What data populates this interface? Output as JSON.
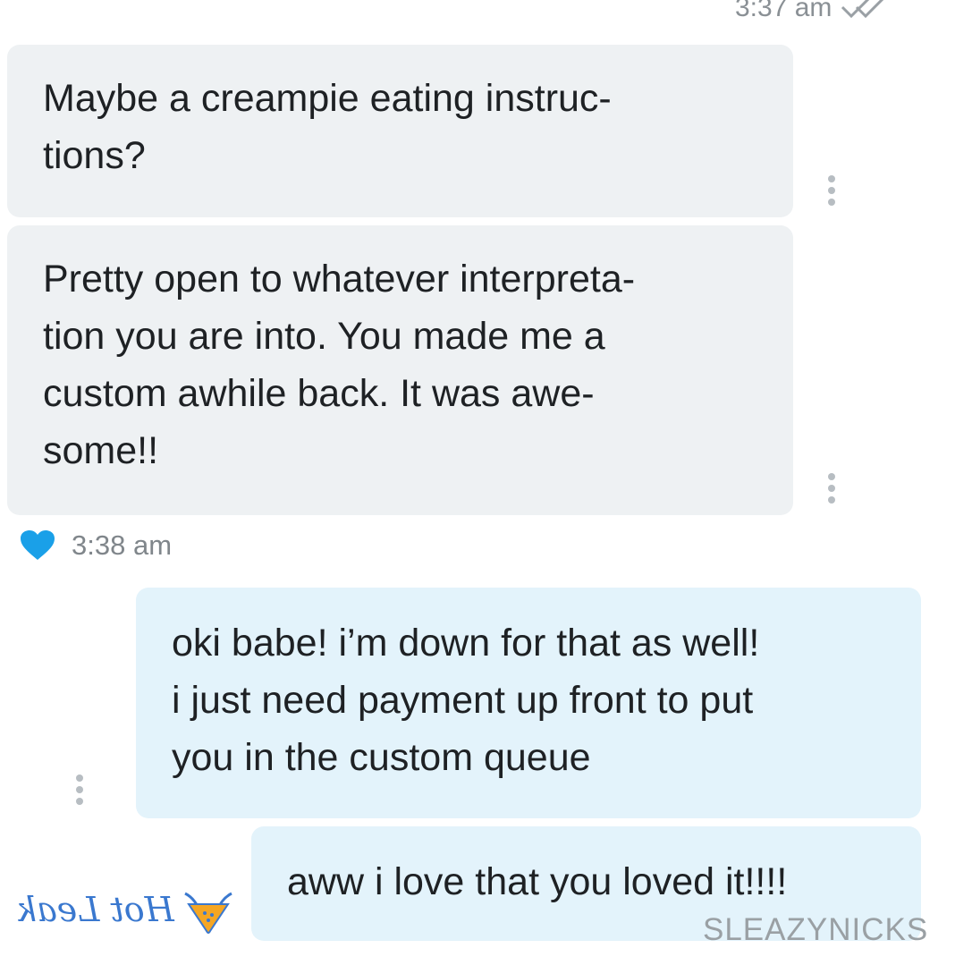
{
  "header": {
    "timestamp": "3:37 am"
  },
  "messages": [
    {
      "direction": "incoming",
      "text": "Maybe a creampie eating instruc-\ntions?"
    },
    {
      "direction": "incoming",
      "text": "Pretty open to whatever interpreta-\ntion you are into. You made me a\ncustom awhile back. It was awe-\nsome!!"
    },
    {
      "direction": "outgoing",
      "text": "oki babe! i’m down for that as well!\ni just need payment up front to put\nyou in the custom queue"
    },
    {
      "direction": "outgoing",
      "text": "aww i love that you loved it!!!!"
    }
  ],
  "like_row": {
    "time": "3:38 am",
    "icon": "heart-icon"
  },
  "watermarks": {
    "logo_text": "Hot Leak",
    "corner_text": "SLEAZYNICKS"
  },
  "colors": {
    "incoming_bubble": "#eef1f3",
    "outgoing_bubble": "#e3f3fb",
    "heart": "#1aa0e8",
    "logo": "#3a78cf"
  }
}
